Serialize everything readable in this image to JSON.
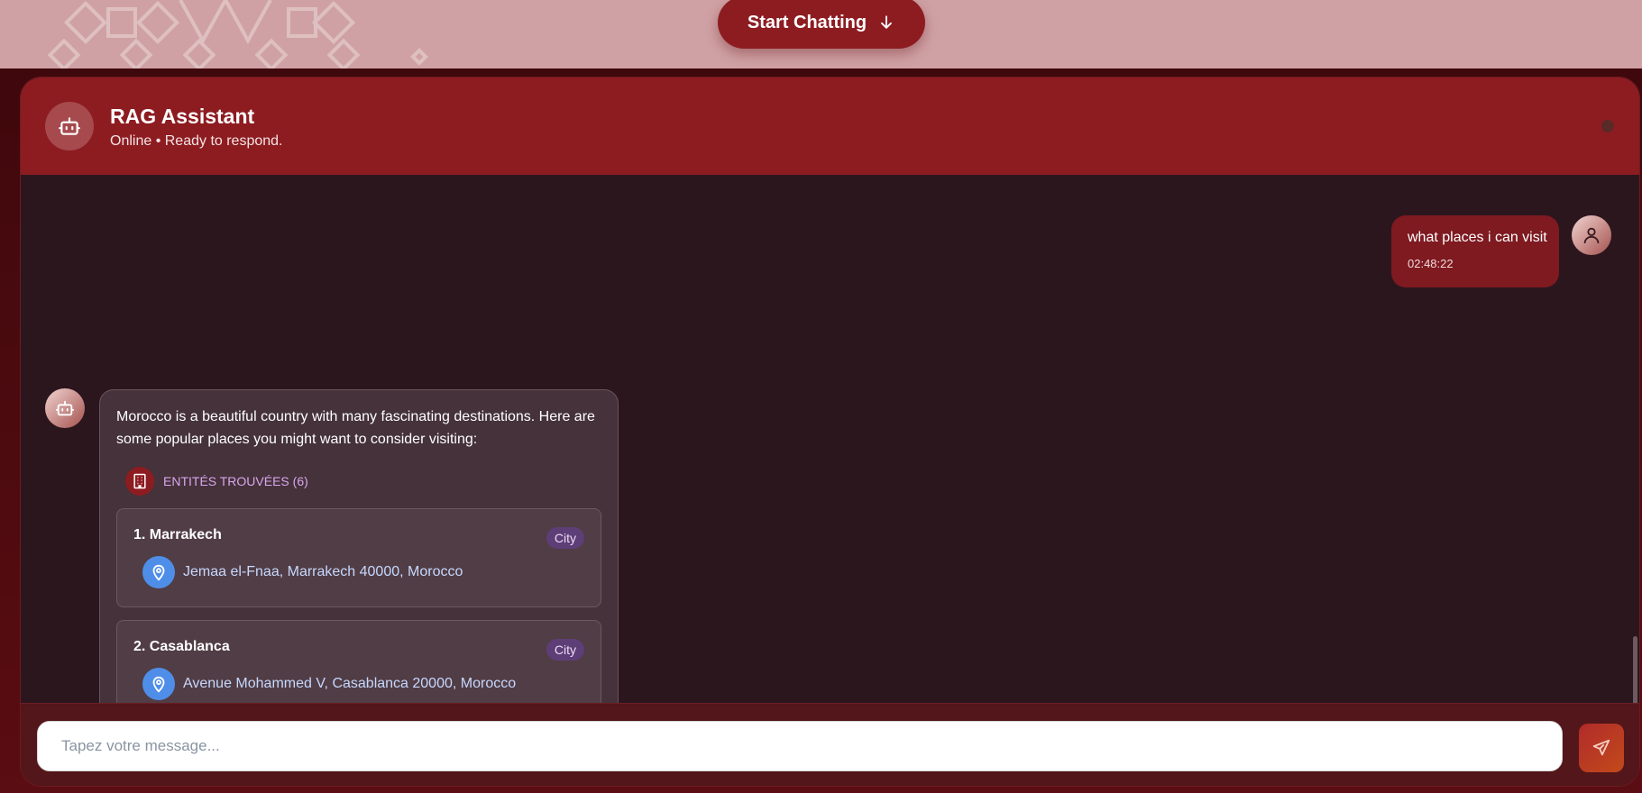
{
  "hero": {
    "cta_label": "Start Chatting",
    "cta_icon": "arrow-down-icon"
  },
  "header": {
    "title": "RAG Assistant",
    "status": "Online • Ready to respond.",
    "avatar_icon": "bot-icon"
  },
  "messages": [
    {
      "role": "user",
      "text": "what places i can visit",
      "time": "02:48:22"
    },
    {
      "role": "assistant",
      "text": "Morocco is a beautiful country with many fascinating destinations. Here are some popular places you might want to consider visiting:",
      "entities_label": "ENTITÉS TROUVÉES (6)",
      "entities": [
        {
          "name": "1. Marrakech",
          "type": "City",
          "address": "Jemaa el-Fnaa, Marrakech 40000, Morocco"
        },
        {
          "name": "2. Casablanca",
          "type": "City",
          "address": "Avenue Mohammed V, Casablanca 20000, Morocco"
        }
      ]
    }
  ],
  "composer": {
    "placeholder": "Tapez votre message...",
    "send_icon": "send-icon"
  },
  "colors": {
    "accent": "#8d1c21",
    "hero_bg": "#d0a1a4",
    "chat_bg": "#2c161e",
    "entity_badge": "#5e3e77",
    "location_pin": "#4f8ee8"
  }
}
